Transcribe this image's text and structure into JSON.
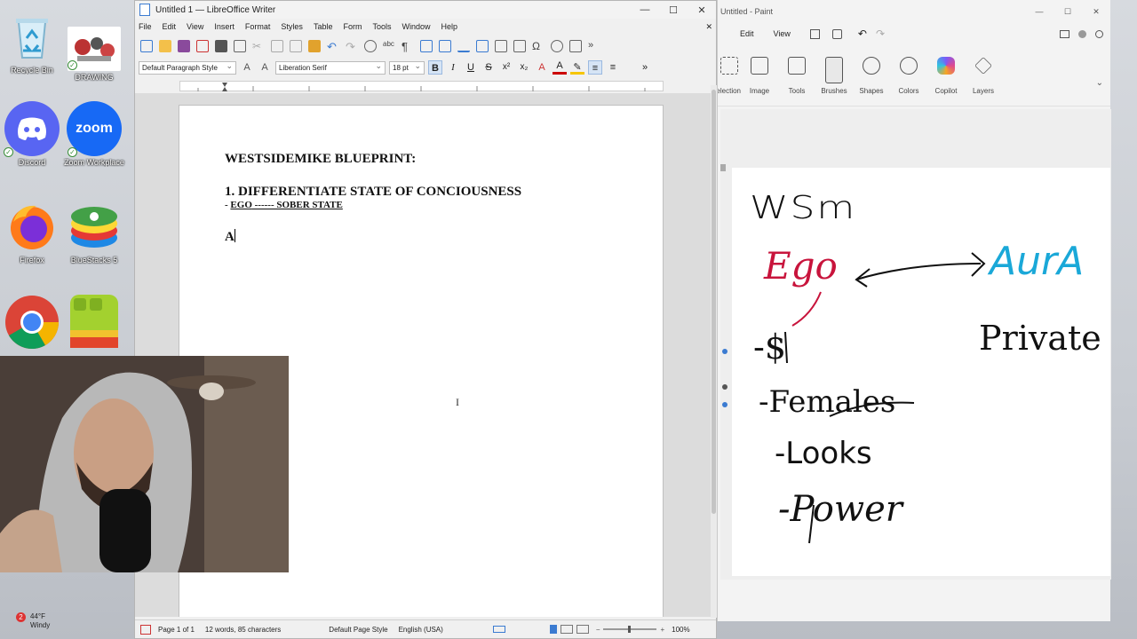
{
  "desktop": {
    "icons": [
      {
        "label": "Recycle Bin"
      },
      {
        "label": "DRAWING"
      },
      {
        "label": "Discord"
      },
      {
        "label": "Zoom Workplace",
        "tile_text": "zoom"
      },
      {
        "label": "Firefox"
      },
      {
        "label": "BlueStacks 5"
      },
      {
        "label": ""
      },
      {
        "label": ""
      }
    ]
  },
  "writer": {
    "title": "Untitled 1 — LibreOffice Writer",
    "menu": [
      "File",
      "Edit",
      "View",
      "Insert",
      "Format",
      "Styles",
      "Table",
      "Form",
      "Tools",
      "Window",
      "Help"
    ],
    "paragraph_style": "Default Paragraph Style",
    "font_name": "Liberation Serif",
    "font_size": "18 pt",
    "bold": "B",
    "italic": "I",
    "underline": "U",
    "strike": "S",
    "doc": {
      "line1": "WESTSIDEMIKE BLUEPRINT:",
      "line2": "1. DIFFERENTIATE STATE OF CONCIOUSNESS",
      "line3_prefix": "- ",
      "line3_ego": "EGO",
      "line3_rest": " ------ SOBER STATE",
      "line4": "A"
    },
    "status": {
      "page": "Page 1 of 1",
      "words": "12 words, 85 characters",
      "page_style": "Default Page Style",
      "language": "English (USA)",
      "zoom": "100%"
    }
  },
  "paint": {
    "title": "Untitled - Paint",
    "menu": [
      "Edit",
      "View"
    ],
    "ribbon": [
      "Selection",
      "Image",
      "Tools",
      "Brushes",
      "Shapes",
      "Colors",
      "Copilot",
      "Layers"
    ],
    "drawing": {
      "word1": "WSm",
      "ego": "Ego",
      "aura": "AurA",
      "private": "Private",
      "item_dash": "-",
      "items": [
        "$",
        "Females",
        "Looks",
        "Power"
      ]
    },
    "colors": {
      "ego": "#c8143c",
      "aura": "#1aa8d8",
      "ink": "#111111"
    }
  },
  "taskbar": {
    "temperature": "44°F",
    "weather": "Windy",
    "badge": "2"
  }
}
